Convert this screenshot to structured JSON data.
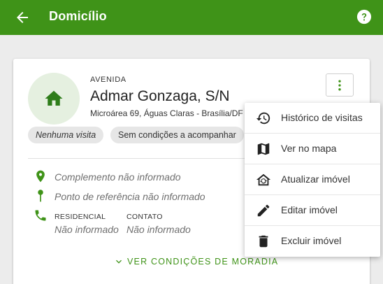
{
  "appbar": {
    "title": "Domicílio",
    "back_icon": "arrow-back-icon",
    "help_icon": "help-circle-icon",
    "color": "#3f9318"
  },
  "property": {
    "type_label": "AVENIDA",
    "street": "Admar Gonzaga, S/N",
    "address": "Microárea 69, Águas Claras - Brasília/DF",
    "icon": "home-icon",
    "chips": [
      "Nenhuma visita",
      "Sem condições a acompanhar"
    ]
  },
  "details": {
    "complement": "Complemento não informado",
    "reference": "Ponto de referência não informado",
    "phone_residential_label": "RESIDENCIAL",
    "phone_residential_value": "Não informado",
    "phone_contact_label": "CONTATO",
    "phone_contact_value": "Não informado"
  },
  "housing_link": "VER CONDIÇÕES DE MORADIA",
  "menu": {
    "items": [
      {
        "label": "Histórico de visitas",
        "icon": "history-icon"
      },
      {
        "label": "Ver no mapa",
        "icon": "map-icon"
      },
      {
        "label": "Atualizar imóvel",
        "icon": "home-sync-icon"
      },
      {
        "label": "Editar imóvel",
        "icon": "pencil-icon"
      },
      {
        "label": "Excluir imóvel",
        "icon": "trash-icon"
      }
    ]
  },
  "colors": {
    "accent": "#3f9318",
    "background": "#ececec"
  }
}
